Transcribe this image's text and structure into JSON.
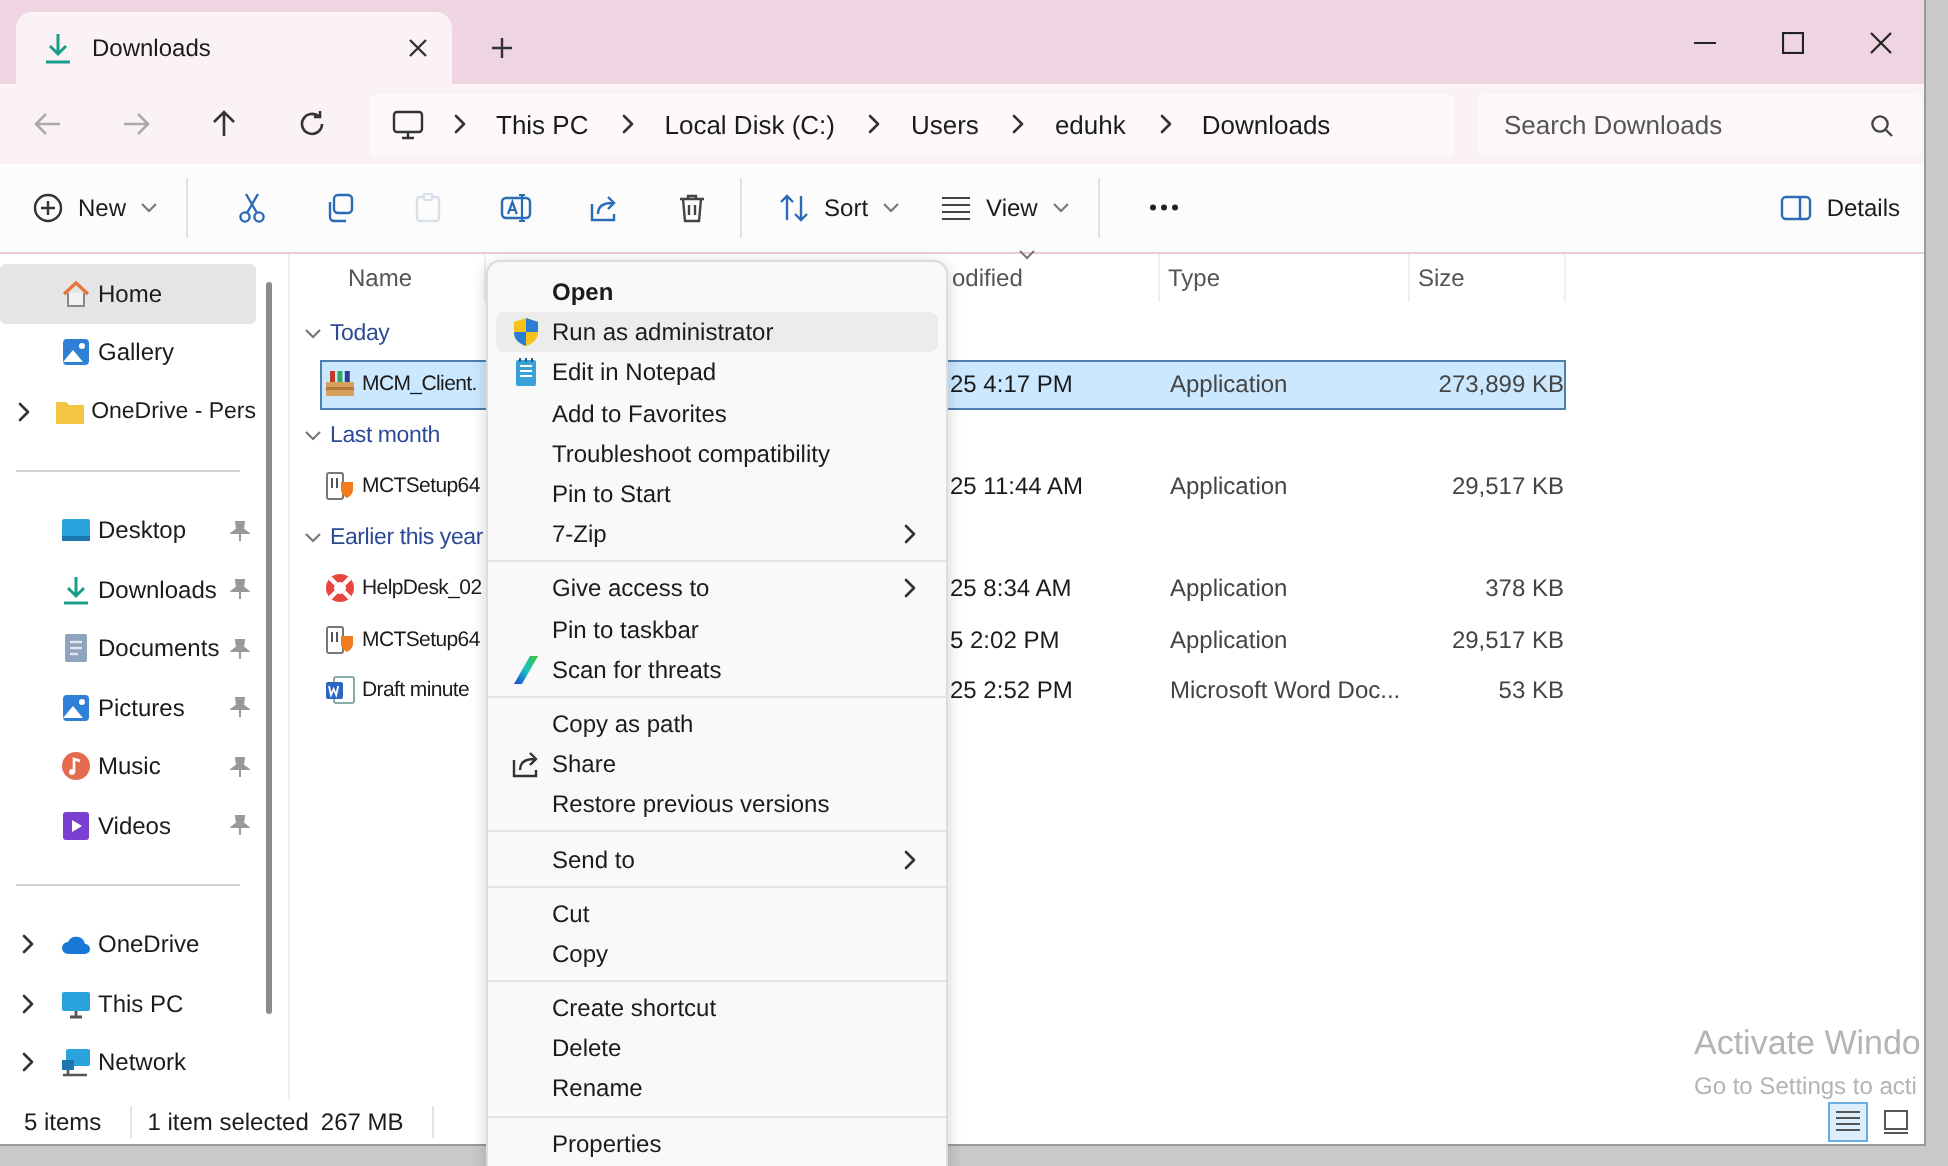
{
  "tabs": [
    {
      "title": "Downloads",
      "selected": true
    }
  ],
  "window_controls": [
    {
      "kind": "minimize"
    },
    {
      "kind": "maximize"
    },
    {
      "kind": "close"
    }
  ],
  "nav": [
    {
      "kind": "back",
      "disabled": true
    },
    {
      "kind": "forward",
      "disabled": true
    },
    {
      "kind": "up",
      "disabled": false
    },
    {
      "kind": "refresh",
      "disabled": false
    }
  ],
  "address": {
    "path": [
      "This PC",
      "Local Disk (C:)",
      "Users",
      "eduhk",
      "Downloads"
    ]
  },
  "search": {
    "placeholder": "Search Downloads"
  },
  "toolbar": [
    {
      "kind": "new",
      "label": "New",
      "disabled": false
    },
    {
      "kind": "separator"
    },
    {
      "kind": "cut",
      "disabled": false
    },
    {
      "kind": "copy",
      "disabled": false
    },
    {
      "kind": "paste",
      "disabled": true
    },
    {
      "kind": "rename",
      "disabled": false
    },
    {
      "kind": "share",
      "disabled": false
    },
    {
      "kind": "delete",
      "disabled": false
    },
    {
      "kind": "separator"
    },
    {
      "kind": "sort",
      "label": "Sort",
      "disabled": false
    },
    {
      "kind": "view",
      "label": "View",
      "disabled": false
    },
    {
      "kind": "separator"
    },
    {
      "kind": "more",
      "disabled": false
    }
  ],
  "details_button": {
    "label": "Details"
  },
  "sidebar": {
    "groups": [
      {
        "items": [
          {
            "label": "Home",
            "kind": "home",
            "selected": true,
            "expandable": false,
            "pinned": false
          },
          {
            "label": "Gallery",
            "kind": "gallery",
            "selected": false,
            "expandable": false,
            "pinned": false
          },
          {
            "label": "OneDrive - Pers",
            "kind": "folder",
            "selected": false,
            "expandable": true,
            "pinned": false
          }
        ]
      },
      {
        "items": [
          {
            "label": "Desktop",
            "kind": "desktop",
            "selected": false,
            "expandable": false,
            "pinned": true
          },
          {
            "label": "Downloads",
            "kind": "download",
            "selected": false,
            "expandable": false,
            "pinned": true
          },
          {
            "label": "Documents",
            "kind": "document",
            "selected": false,
            "expandable": false,
            "pinned": true
          },
          {
            "label": "Pictures",
            "kind": "gallery",
            "selected": false,
            "expandable": false,
            "pinned": true
          },
          {
            "label": "Music",
            "kind": "music",
            "selected": false,
            "expandable": false,
            "pinned": true
          },
          {
            "label": "Videos",
            "kind": "video",
            "selected": false,
            "expandable": false,
            "pinned": true
          }
        ]
      },
      {
        "items": [
          {
            "label": "OneDrive",
            "kind": "cloud",
            "selected": false,
            "expandable": true,
            "pinned": false
          },
          {
            "label": "This PC",
            "kind": "monitor",
            "selected": false,
            "expandable": true,
            "pinned": false
          },
          {
            "label": "Network",
            "kind": "network",
            "selected": false,
            "expandable": true,
            "pinned": false
          }
        ]
      }
    ]
  },
  "columns": [
    {
      "label": "Name",
      "sorted": false
    },
    {
      "label": "odified",
      "sorted": true
    },
    {
      "label": "Type",
      "sorted": false
    },
    {
      "label": "Size",
      "sorted": false
    }
  ],
  "groups": [
    {
      "label": "Today",
      "expanded": true,
      "files": [
        {
          "name": "MCM_Client.",
          "kind": "archive",
          "modified": "25 4:17 PM",
          "type": "Application",
          "size": "273,899 KB",
          "selected": true
        }
      ]
    },
    {
      "label": "Last month",
      "expanded": true,
      "files": [
        {
          "name": "MCTSetup64",
          "kind": "setup",
          "modified": "25 11:44 AM",
          "type": "Application",
          "size": "29,517 KB",
          "selected": false
        }
      ]
    },
    {
      "label": "Earlier this year",
      "expanded": true,
      "files": [
        {
          "name": "HelpDesk_02",
          "kind": "lifebuoy",
          "modified": "25 8:34 AM",
          "type": "Application",
          "size": "378 KB",
          "selected": false
        },
        {
          "name": "MCTSetup64",
          "kind": "setup",
          "modified": "5 2:02 PM",
          "type": "Application",
          "size": "29,517 KB",
          "selected": false
        },
        {
          "name": "Draft minute",
          "kind": "word",
          "modified": "25 2:52 PM",
          "type": "Microsoft Word Doc...",
          "size": "53 KB",
          "selected": false
        }
      ]
    }
  ],
  "status_bar": {
    "count": "5 items",
    "selection": "1 item selected",
    "selection_size": "267 MB"
  },
  "views": [
    {
      "kind": "details",
      "selected": true
    },
    {
      "kind": "tiles",
      "selected": false
    }
  ],
  "activation_notice": {
    "title": "Activate Windo",
    "subtitle": "Go to Settings to acti"
  },
  "context_menu": [
    {
      "kind": "item",
      "label": "Open",
      "bold": true,
      "submenu": false,
      "hovered": false
    },
    {
      "kind": "shield",
      "label": "Run as administrator",
      "bold": false,
      "submenu": false,
      "hovered": true
    },
    {
      "kind": "notepad",
      "label": "Edit in Notepad",
      "bold": false,
      "submenu": false,
      "hovered": false
    },
    {
      "kind": "item",
      "label": "Add to Favorites",
      "bold": false,
      "submenu": false,
      "hovered": false
    },
    {
      "kind": "item",
      "label": "Troubleshoot compatibility",
      "bold": false,
      "submenu": false,
      "hovered": false
    },
    {
      "kind": "item",
      "label": "Pin to Start",
      "bold": false,
      "submenu": false,
      "hovered": false
    },
    {
      "kind": "item",
      "label": "7-Zip",
      "bold": false,
      "submenu": true,
      "hovered": false
    },
    {
      "kind": "separator"
    },
    {
      "kind": "item",
      "label": "Give access to",
      "bold": false,
      "submenu": true,
      "hovered": false
    },
    {
      "kind": "item",
      "label": "Pin to taskbar",
      "bold": false,
      "submenu": false,
      "hovered": false
    },
    {
      "kind": "scan",
      "label": "Scan for threats",
      "bold": false,
      "submenu": false,
      "hovered": false
    },
    {
      "kind": "separator"
    },
    {
      "kind": "item",
      "label": "Copy as path",
      "bold": false,
      "submenu": false,
      "hovered": false
    },
    {
      "kind": "share",
      "label": "Share",
      "bold": false,
      "submenu": false,
      "hovered": false
    },
    {
      "kind": "item",
      "label": "Restore previous versions",
      "bold": false,
      "submenu": false,
      "hovered": false
    },
    {
      "kind": "separator"
    },
    {
      "kind": "item",
      "label": "Send to",
      "bold": false,
      "submenu": true,
      "hovered": false
    },
    {
      "kind": "separator"
    },
    {
      "kind": "item",
      "label": "Cut",
      "bold": false,
      "submenu": false,
      "hovered": false
    },
    {
      "kind": "item",
      "label": "Copy",
      "bold": false,
      "submenu": false,
      "hovered": false
    },
    {
      "kind": "separator"
    },
    {
      "kind": "item",
      "label": "Create shortcut",
      "bold": false,
      "submenu": false,
      "hovered": false
    },
    {
      "kind": "item",
      "label": "Delete",
      "bold": false,
      "submenu": false,
      "hovered": false
    },
    {
      "kind": "item",
      "label": "Rename",
      "bold": false,
      "submenu": false,
      "hovered": false
    },
    {
      "kind": "separator"
    },
    {
      "kind": "item",
      "label": "Properties",
      "bold": false,
      "submenu": false,
      "hovered": false
    }
  ]
}
